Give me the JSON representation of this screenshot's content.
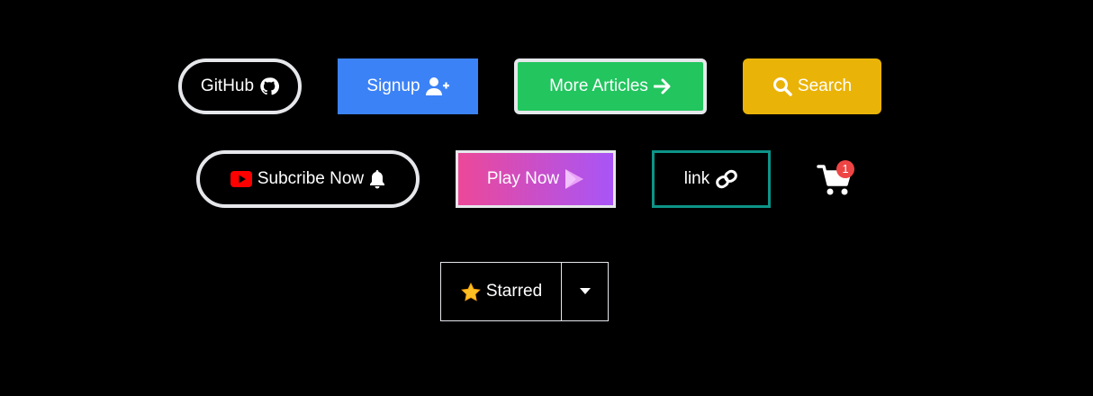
{
  "buttons": {
    "github": {
      "label": "GitHub",
      "icon": "github-icon"
    },
    "signup": {
      "label": "Signup",
      "icon": "user-plus-icon",
      "color": "#3b82f6"
    },
    "more_articles": {
      "label": "More Articles",
      "icon": "arrow-right-icon",
      "color": "#22c55e"
    },
    "search": {
      "label": "Search",
      "icon": "search-icon",
      "color": "#eab308"
    },
    "subscribe": {
      "label": "Subcribe Now",
      "icon_left": "youtube-icon",
      "icon_right": "bell-icon"
    },
    "play_now": {
      "label": "Play Now",
      "icon": "play-store-icon",
      "gradient": [
        "#ec4899",
        "#a855f7"
      ]
    },
    "link": {
      "label": "link",
      "icon": "link-icon",
      "border_color": "#0d9488"
    },
    "cart": {
      "icon": "shopping-cart-icon",
      "badge_count": "1",
      "badge_color": "#ef4444"
    },
    "starred": {
      "label": "Starred",
      "icon": "star-icon"
    },
    "dropdown": {
      "icon": "caret-down-icon"
    }
  }
}
